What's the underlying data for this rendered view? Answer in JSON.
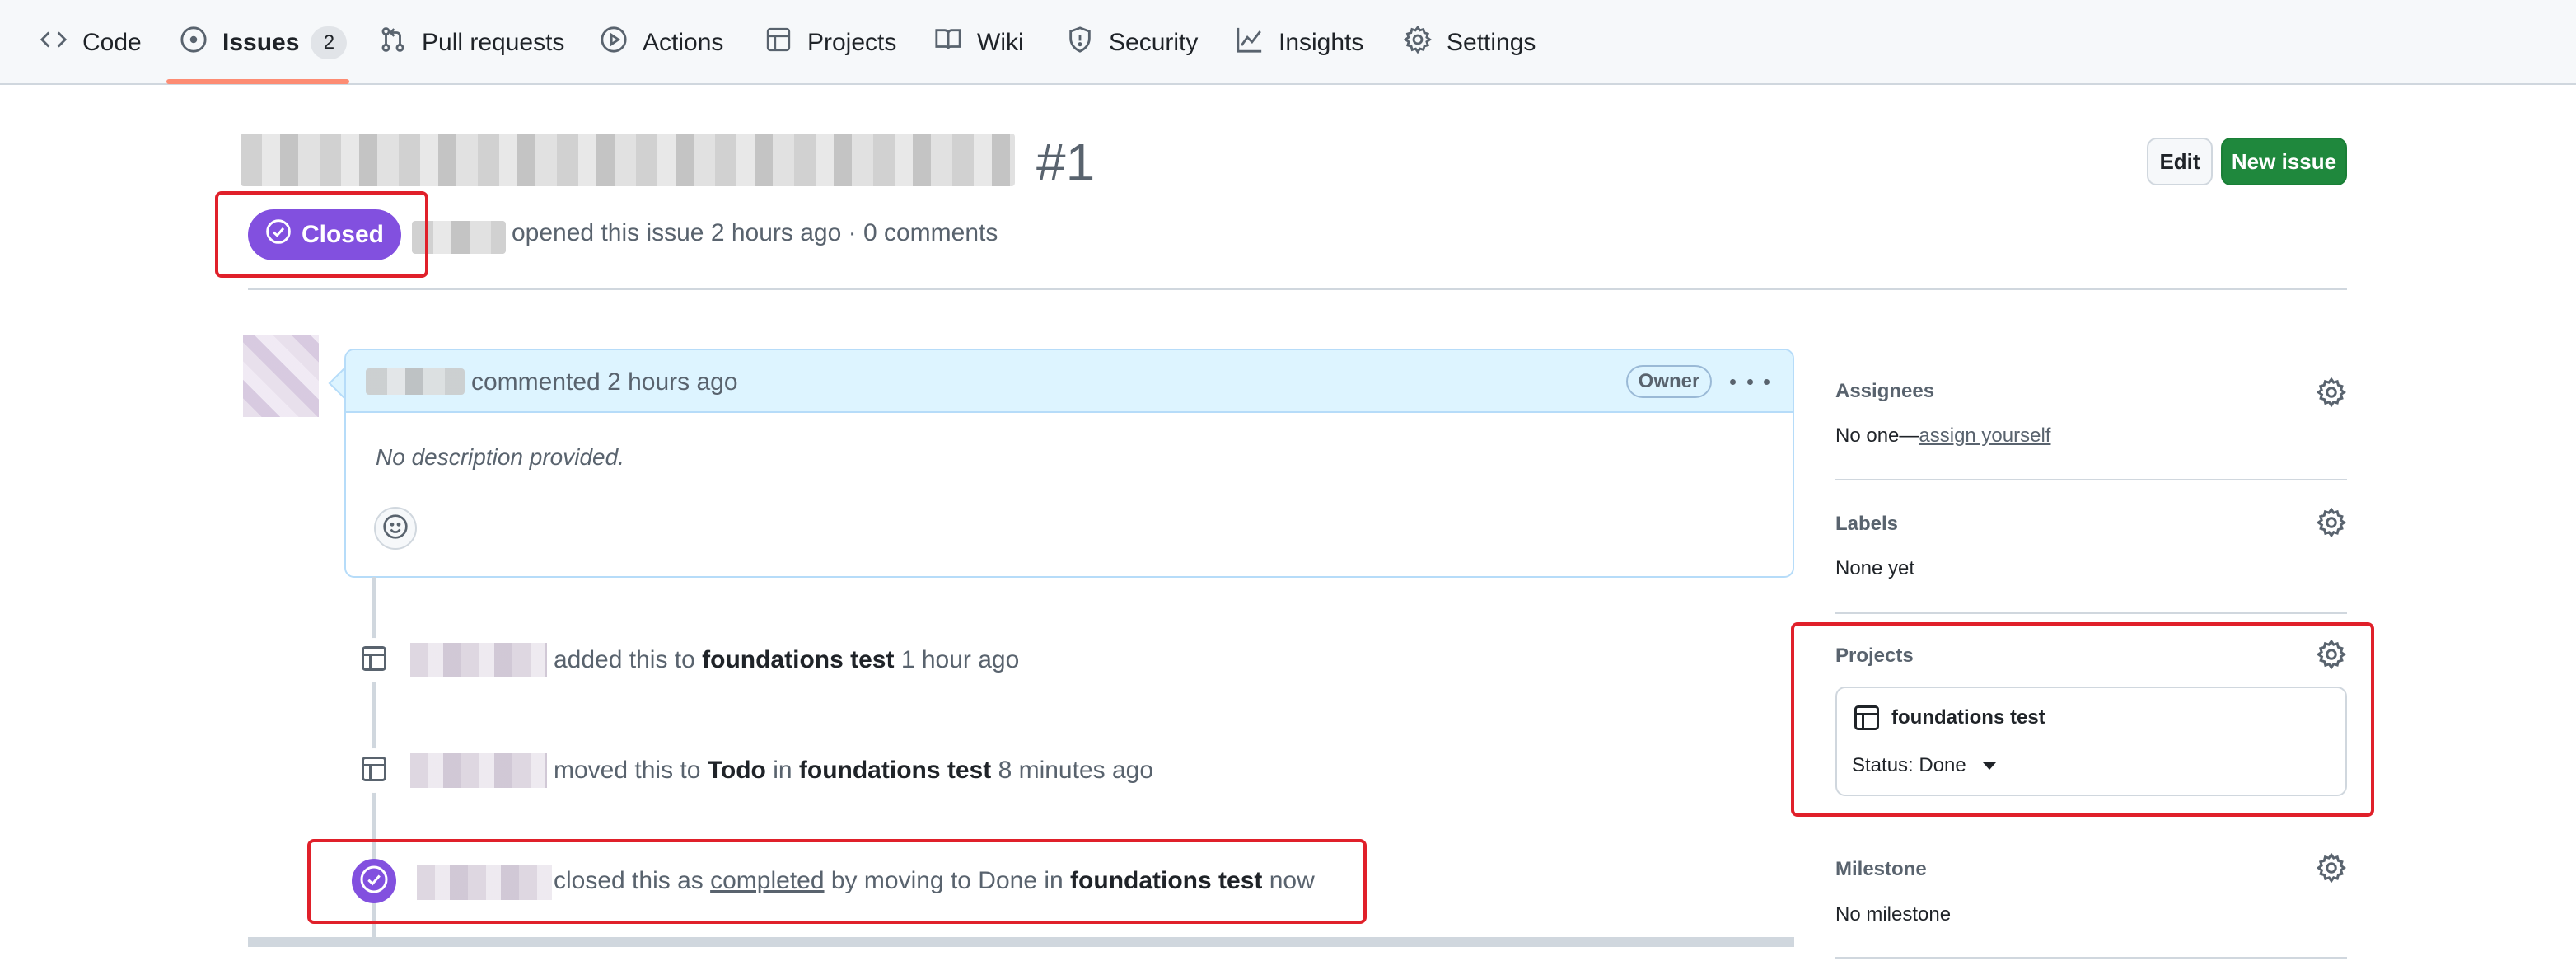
{
  "nav": {
    "items": [
      {
        "label": "Code",
        "icon": "code-icon"
      },
      {
        "label": "Issues",
        "icon": "issue-opened-icon",
        "counter": "2",
        "selected": true
      },
      {
        "label": "Pull requests",
        "icon": "git-pull-request-icon"
      },
      {
        "label": "Actions",
        "icon": "play-icon"
      },
      {
        "label": "Projects",
        "icon": "table-icon"
      },
      {
        "label": "Wiki",
        "icon": "book-icon"
      },
      {
        "label": "Security",
        "icon": "shield-icon"
      },
      {
        "label": "Insights",
        "icon": "graph-icon"
      },
      {
        "label": "Settings",
        "icon": "gear-icon"
      }
    ]
  },
  "issue": {
    "number": "#1",
    "state": "Closed",
    "meta": "opened this issue 2 hours ago · 0 comments",
    "edit_label": "Edit",
    "new_issue_label": "New issue"
  },
  "comment": {
    "timestamp": "commented 2 hours ago",
    "role_badge": "Owner",
    "body": "No description provided."
  },
  "timeline": {
    "event1": {
      "action": "added this to",
      "project": "foundations test",
      "time": "1 hour ago"
    },
    "event2": {
      "action": "moved this to",
      "column": "Todo",
      "connector": "in",
      "project": "foundations test",
      "time": "8 minutes ago"
    },
    "event3": {
      "action": "closed this as",
      "reason": "completed",
      "middle": "by moving to Done in",
      "project": "foundations test",
      "time": "now"
    }
  },
  "sidebar": {
    "assignees": {
      "heading": "Assignees",
      "value": "No one—",
      "link": "assign yourself"
    },
    "labels": {
      "heading": "Labels",
      "value": "None yet"
    },
    "projects": {
      "heading": "Projects",
      "project_name": "foundations test",
      "status": "Status: Done"
    },
    "milestone": {
      "heading": "Milestone",
      "value": "No milestone"
    }
  },
  "colors": {
    "closed_purple": "#8250df",
    "primary_green": "#1f883d",
    "nav_underline": "#fd8c73",
    "highlight_red": "#e0202a",
    "comment_header_bg": "#ddf4ff"
  }
}
